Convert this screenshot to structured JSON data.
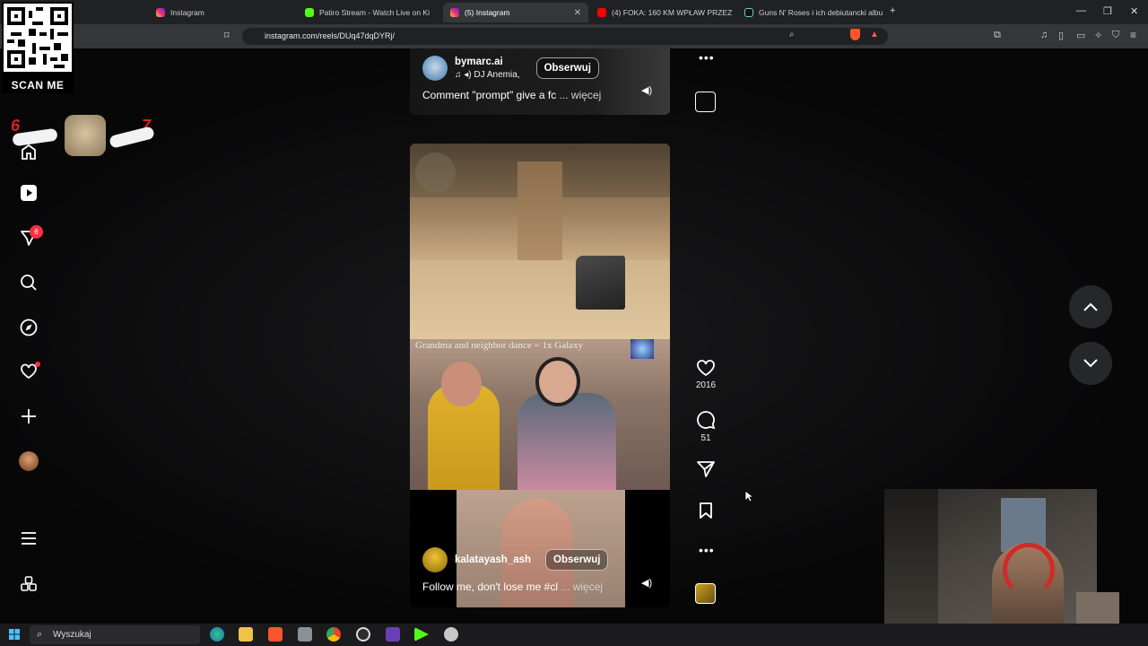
{
  "browser": {
    "tabs": [
      {
        "title": "Instagram",
        "color": "#e1306c"
      },
      {
        "title": "Patiro Stream - Watch Live on Ki",
        "color": "#53fc18"
      },
      {
        "title": "(5) Instagram",
        "color": "#e1306c"
      },
      {
        "title": "(4) FOKA: 160 KM WPŁAW PRZEZ BA",
        "color": "#ff0000"
      },
      {
        "title": "Guns N' Roses i ich debiutancki albu",
        "color": "#ffffff"
      }
    ],
    "url": "instagram.com/reels/DUq47dqDYRj/"
  },
  "overlay": {
    "qr_label": "SCAN ME",
    "sticker_left": "6",
    "sticker_right": "7"
  },
  "sidebar": {
    "notification_count": "6"
  },
  "reel_prev": {
    "username": "bymarc.ai",
    "audio": "DJ Anemia,",
    "follow_label": "Obserwuj",
    "caption": "Comment \"prompt\" give a fc",
    "more": "... więcej"
  },
  "reel_current": {
    "overlay_caption": "Grandma and neighbor dance = 1x Galaxy",
    "username": "kalatayash_ash",
    "follow_label": "Obserwuj",
    "caption": "Follow me, don't lose me #cl",
    "more": "... więcej",
    "likes": "2016",
    "comments": "51"
  },
  "taskbar": {
    "search_placeholder": "Wyszukaj"
  },
  "colors": {
    "accent": "#ff3040",
    "instagram": "#e1306c"
  }
}
